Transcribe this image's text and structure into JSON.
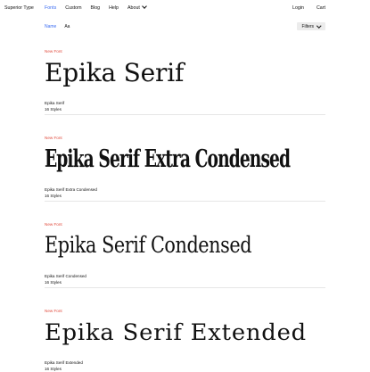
{
  "header": {
    "brand": "Superior Type",
    "nav": [
      {
        "label": "Fonts",
        "active": true
      },
      {
        "label": "Custom"
      },
      {
        "label": "Blog"
      },
      {
        "label": "Help"
      },
      {
        "label": "About"
      }
    ],
    "login": "Login",
    "cart": "Cart"
  },
  "toolbar": {
    "sort_name": "Name",
    "sort_aa": "Aa",
    "filters": "Filters"
  },
  "fonts": [
    {
      "badge": "New Font",
      "specimen": "Epika Serif",
      "name": "Epika Serif",
      "styles": "16 Styles"
    },
    {
      "badge": "New Font",
      "specimen": "Epika Serif Extra Condensed",
      "name": "Epika Serif Extra Condensed",
      "styles": "16 Styles"
    },
    {
      "badge": "New Font",
      "specimen": "Epika Serif Condensed",
      "name": "Epika Serif Condensed",
      "styles": "16 Styles"
    },
    {
      "badge": "New Font",
      "specimen": "Epika Serif Extended",
      "name": "Epika Serif Extended",
      "styles": "16 Styles"
    }
  ],
  "colors": {
    "accent": "#3b6cf2",
    "badge": "#e0483a"
  }
}
